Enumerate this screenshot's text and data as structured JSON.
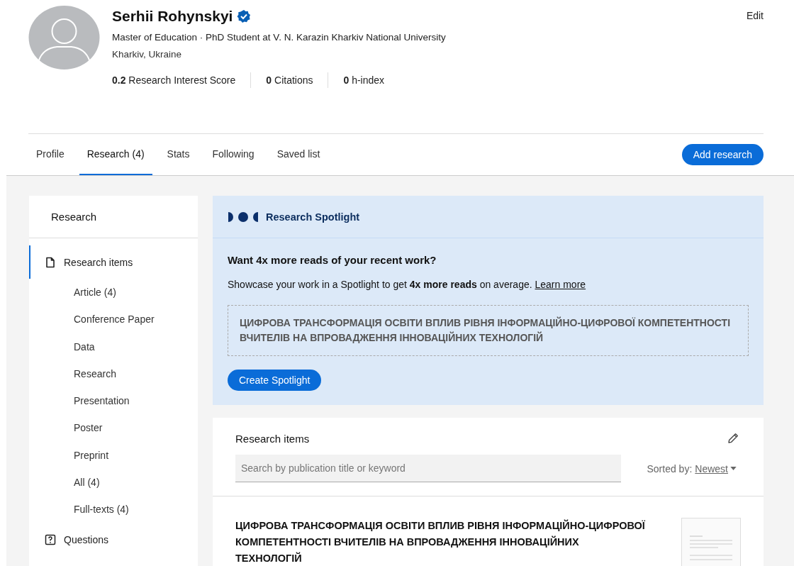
{
  "profile": {
    "name": "Serhii Rohynskyi",
    "verified": true,
    "headline": "Master of Education · PhD Student at V. N. Karazin Kharkiv National University",
    "location": "Kharkiv, Ukraine",
    "edit": "Edit",
    "stats": [
      {
        "value": "0.2",
        "label": "Research Interest Score"
      },
      {
        "value": "0",
        "label": "Citations"
      },
      {
        "value": "0",
        "label": "h-index"
      }
    ]
  },
  "tabs": [
    {
      "label": "Profile",
      "selected": false
    },
    {
      "label": "Research (4)",
      "selected": true
    },
    {
      "label": "Stats",
      "selected": false
    },
    {
      "label": "Following",
      "selected": false
    },
    {
      "label": "Saved list",
      "selected": false
    }
  ],
  "add_button": "Add research",
  "sidebar": {
    "title": "Research",
    "items": [
      {
        "label": "Research items",
        "kind": "document",
        "selected": true,
        "children": [
          {
            "label": "Article (4)"
          },
          {
            "label": "Conference Paper"
          },
          {
            "label": "Data"
          },
          {
            "label": "Research"
          },
          {
            "label": "Presentation"
          },
          {
            "label": "Poster"
          },
          {
            "label": "Preprint"
          },
          {
            "label": "All (4)"
          },
          {
            "label": "Full-texts (4)"
          }
        ]
      },
      {
        "label": "Questions",
        "kind": "question",
        "selected": false
      }
    ]
  },
  "spotlight": {
    "title": "Research Spotlight",
    "heading": "Want 4x more reads of your recent work?",
    "body": "Showcase your work in a Spotlight to get **4x more reads** on average.",
    "link": "Learn more",
    "featured": "ЦИФРОВА ТРАНСФОРМАЦІЯ ОСВІТИ ВПЛИВ РІВНЯ ІНФОРМАЦІЙНО-ЦИФРОВОЇ КОМПЕТЕНТНОСТІ ВЧИТЕЛІВ НА ВПРОВАДЖЕННЯ ІННОВАЦІЙНИХ ТЕХНОЛОГІЙ",
    "button": "Create Spotlight"
  },
  "research_items": {
    "title": "Research items",
    "search": {
      "placeholder": "Search by publication title or keyword"
    },
    "sort_label": "Sorted by:",
    "sort_value": "Newest",
    "items": [
      {
        "title": "ЦИФРОВА ТРАНСФОРМАЦІЯ ОСВІТИ ВПЛИВ РІВНЯ ІНФОРМАЦІЙНО-ЦИФРОВОЇ КОМПЕТЕНТНОСТІ ВЧИТЕЛІВ НА ВПРОВАДЖЕННЯ ІННОВАЦІЙНИХ ТЕХНОЛОГІЙ"
      }
    ]
  }
}
